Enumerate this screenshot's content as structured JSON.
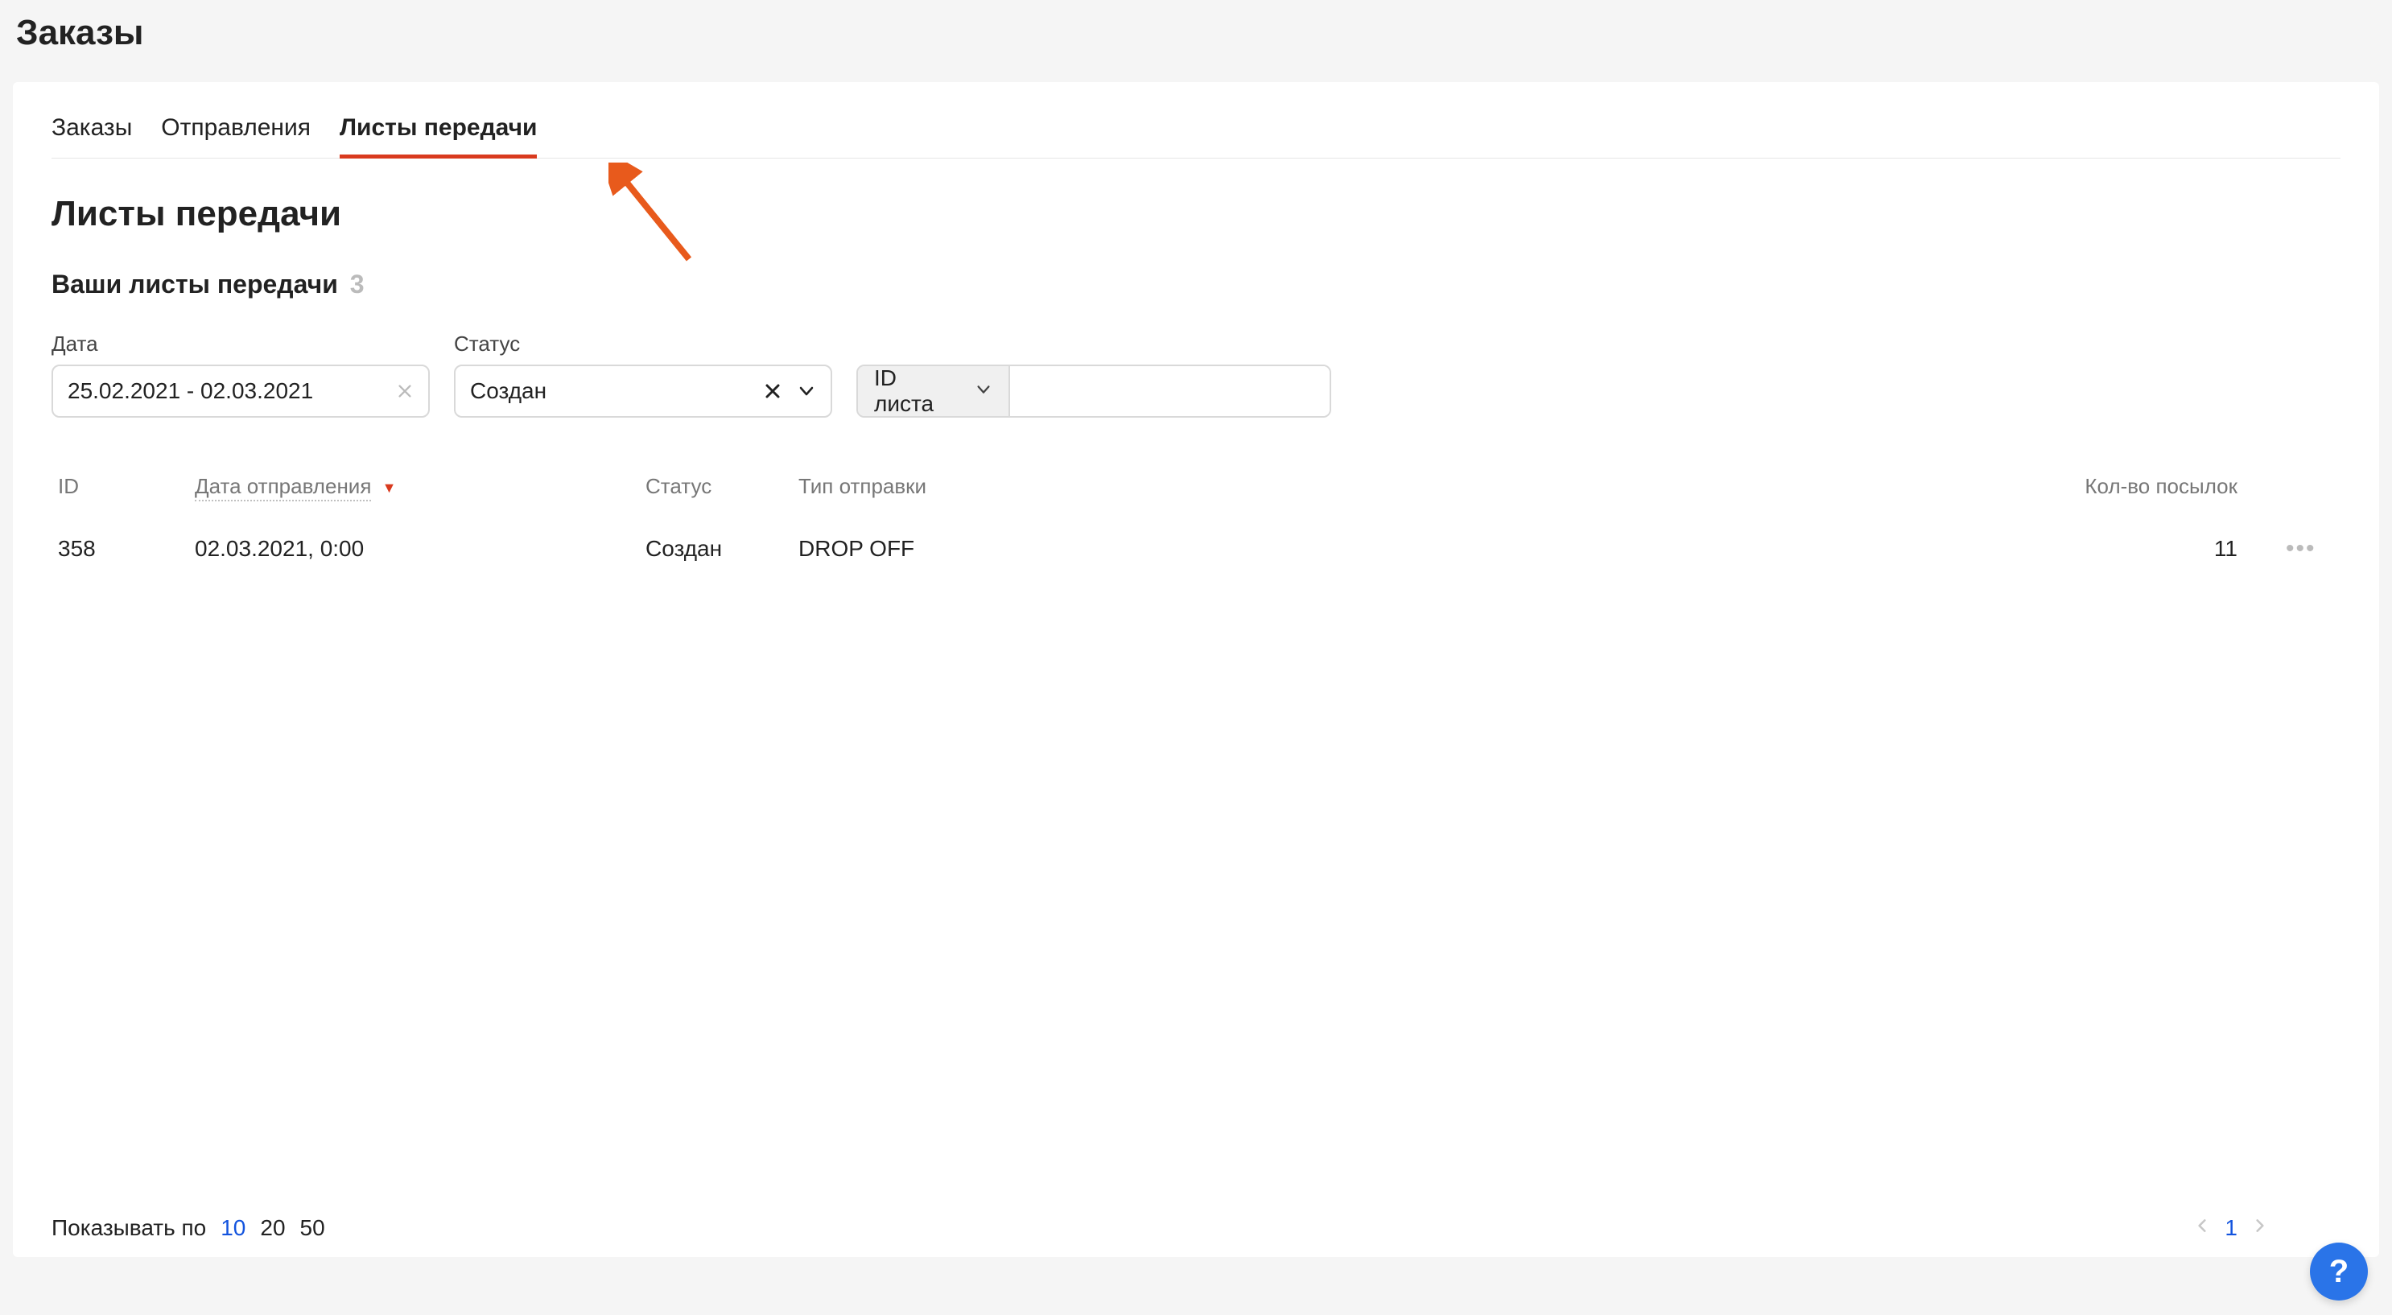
{
  "page": {
    "title": "Заказы"
  },
  "tabs": [
    {
      "label": "Заказы"
    },
    {
      "label": "Отправления"
    },
    {
      "label": "Листы передачи"
    }
  ],
  "section": {
    "title": "Листы передачи",
    "sub_title": "Ваши листы передачи",
    "count": "3"
  },
  "filters": {
    "date_label": "Дата",
    "date_value": "25.02.2021 - 02.03.2021",
    "status_label": "Статус",
    "status_value": "Создан",
    "search_type": "ID листа",
    "search_value": ""
  },
  "table": {
    "headers": {
      "id": "ID",
      "date": "Дата отправления",
      "status": "Статус",
      "type": "Тип отправки",
      "qty": "Кол-во посылок"
    },
    "rows": [
      {
        "id": "358",
        "date": "02.03.2021, 0:00",
        "status": "Создан",
        "type": "DROP OFF",
        "qty": "11"
      }
    ]
  },
  "footer": {
    "page_size_label": "Показывать по",
    "page_sizes": [
      "10",
      "20",
      "50"
    ],
    "page_size_active": "10",
    "current_page": "1"
  },
  "help": "?"
}
